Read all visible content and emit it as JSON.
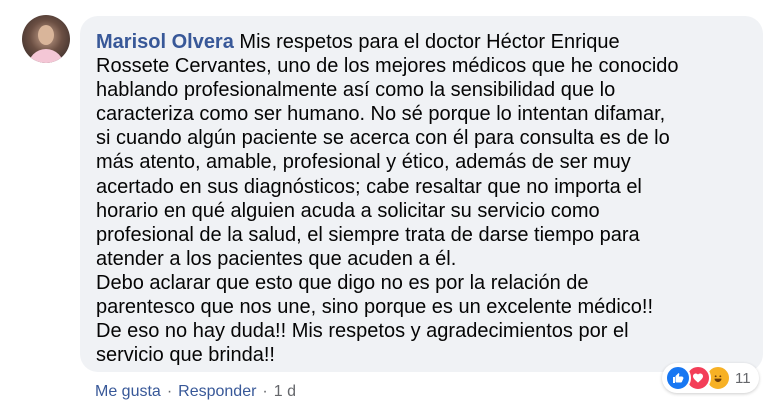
{
  "comment": {
    "author": "Marisol Olvera",
    "text": "Mis respetos para el doctor Héctor Enrique\nRossete Cervantes, uno de los mejores médicos que he conocido\nhablando profesionalmente así como la sensibilidad que lo\ncaracteriza como ser humano. No sé porque lo intentan difamar,\nsi cuando algún paciente se acerca con él para consulta es de lo\nmás atento, amable, profesional y ético, además de ser muy\nacertado en sus diagnósticos; cabe resaltar que no importa el\nhorario en qué alguien acuda a solicitar su servicio como\nprofesional de la salud, el siempre trata de darse tiempo para\natender a los pacientes que acuden a él.\nDebo aclarar que esto que digo no es por la relación de\nparentesco que nos une, sino porque es un excelente médico!!\nDe eso no hay duda!! Mis respetos y agradecimientos por el\nservicio que brinda!!"
  },
  "actions": {
    "like_label": "Me gusta",
    "separator": "·",
    "reply_label": "Responder",
    "time": "1 d"
  },
  "reactions": {
    "count": "11",
    "icons": [
      "like-icon",
      "love-icon",
      "haha-icon"
    ],
    "colors": {
      "like": "#1877f2",
      "love": "#f33e58",
      "haha": "#f7b125"
    }
  }
}
